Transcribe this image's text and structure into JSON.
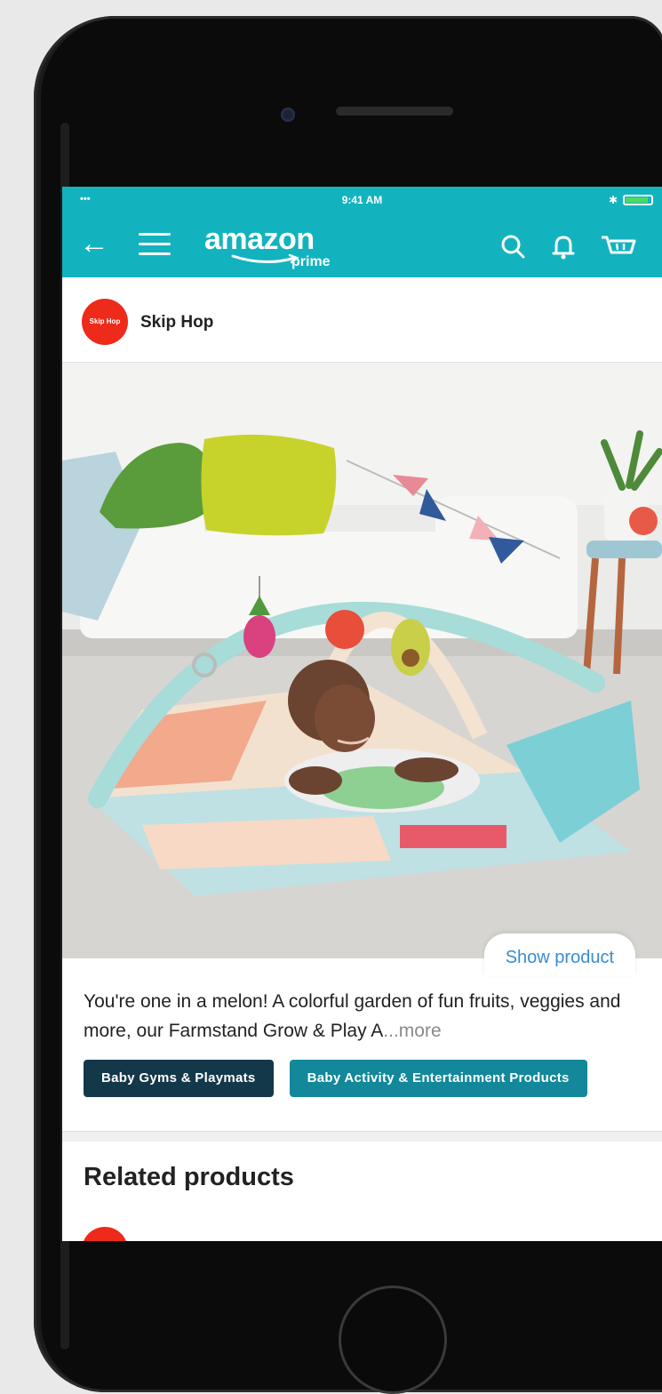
{
  "status_bar": {
    "time": "9:41 AM",
    "carrier": "•••",
    "bt": "✱"
  },
  "app_bar": {
    "back_glyph": "←",
    "logo_text": "amazon",
    "logo_sub": "prime",
    "accent_color": "#12b3bf"
  },
  "post": {
    "brand_name": "Skip Hop",
    "brand_avatar_text": "Skip Hop",
    "show_product_label": "Show product",
    "description": "You're one in a melon! A colorful garden of fun fruits, veggies and more, our Farmstand Grow & Play A",
    "more_label": "...more",
    "tags": [
      "Baby Gyms & Playmats",
      "Baby Activity & Entertainment Products"
    ]
  },
  "related": {
    "title": "Related products"
  },
  "icons": [
    "back-arrow-icon",
    "hamburger-menu-icon",
    "search-icon",
    "bell-icon",
    "cart-icon"
  ]
}
